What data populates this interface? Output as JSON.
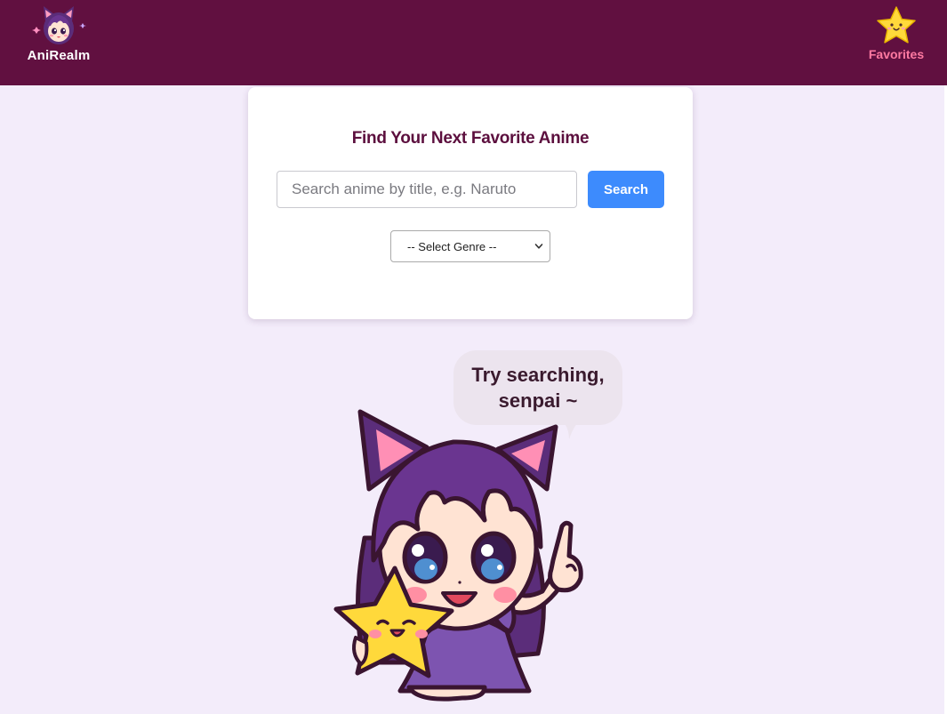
{
  "header": {
    "brand_name": "AniRealm",
    "favorites_label": "Favorites",
    "logo_icon": "anime-girl-avatar-icon",
    "favorites_icon": "smiling-star-icon"
  },
  "search": {
    "title": "Find Your Next Favorite Anime",
    "placeholder": "Search anime by title, e.g. Naruto",
    "value": "",
    "button_label": "Search",
    "genre_selected": "-- Select Genre --"
  },
  "mascot": {
    "speech_line1": "Try searching,",
    "speech_line2": "senpai ~",
    "illustration": "cat-ear-anime-girl-holding-star"
  },
  "colors": {
    "header_bg": "#611040",
    "page_bg": "#f3ecfa",
    "title_color": "#5c0f3e",
    "button_bg": "#3d8bfd",
    "favorites_text": "#ff7aa2",
    "star_yellow": "#ffd93b",
    "hair_purple": "#5b2d7a"
  }
}
